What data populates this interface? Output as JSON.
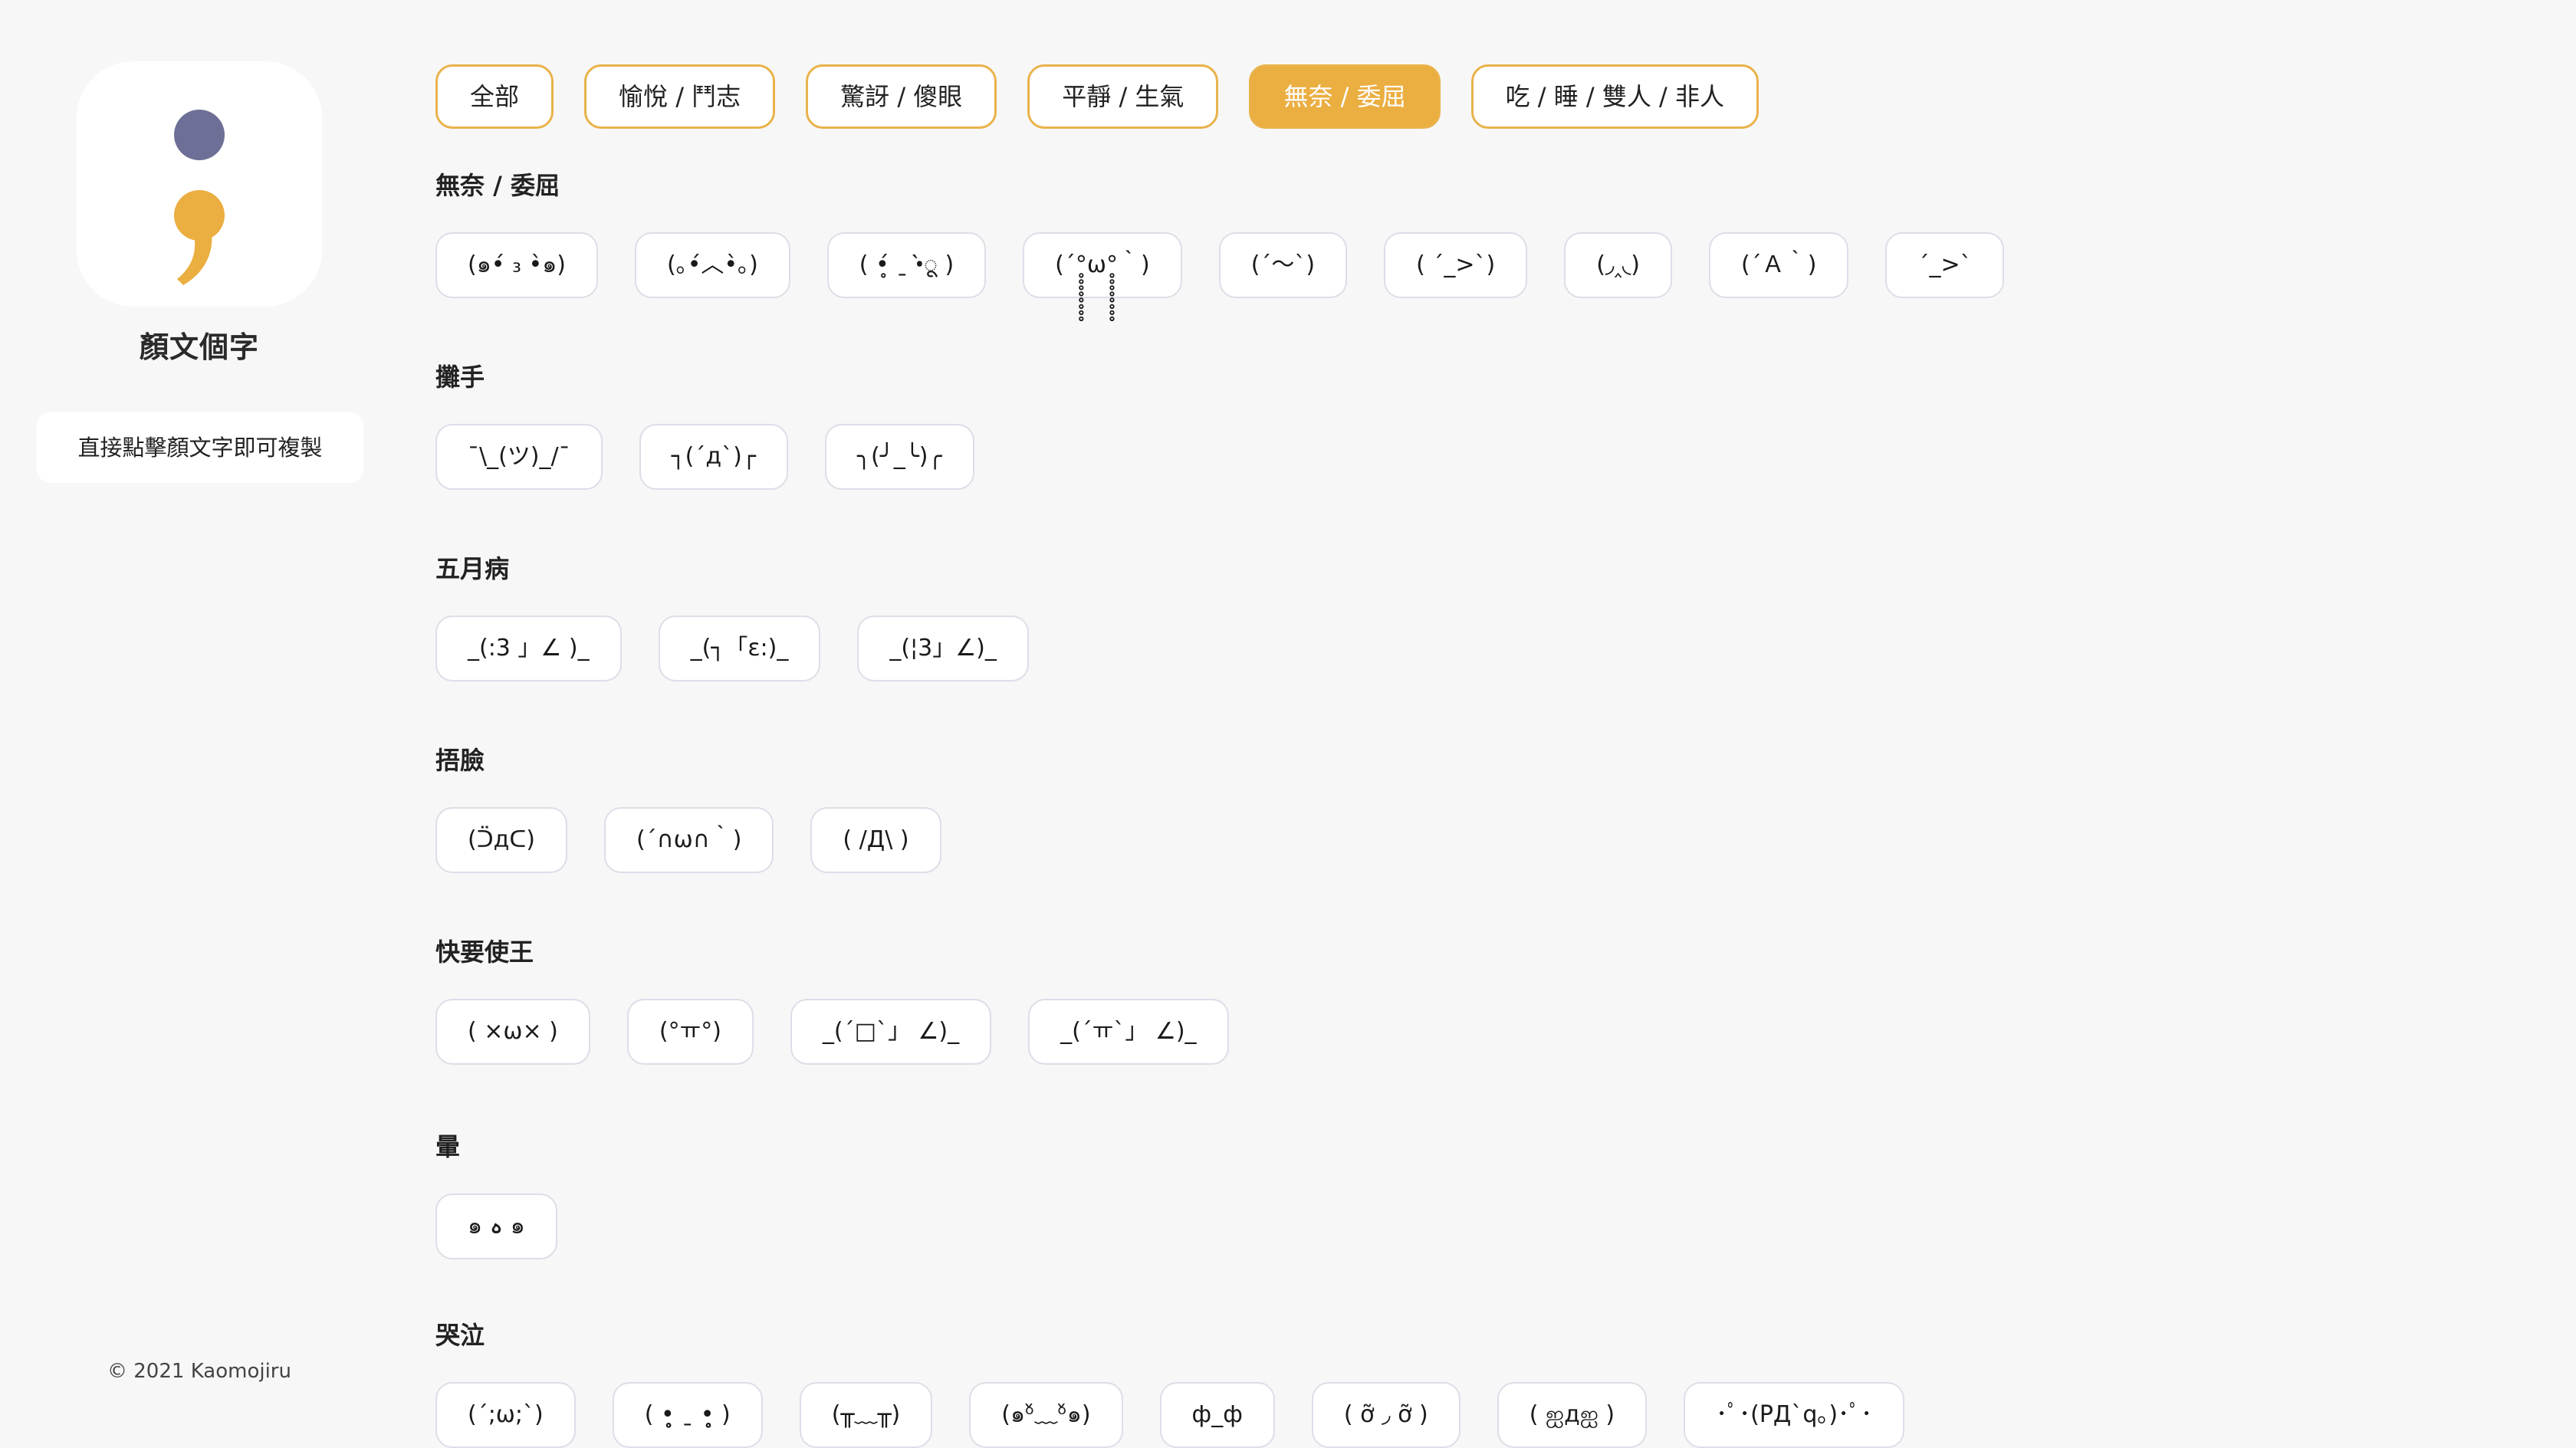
{
  "app": {
    "title": "顏文個字",
    "hint": "直接點擊顏文字即可複製",
    "footer": "© 2021 Kaomojiru",
    "colors": {
      "accent": "#ebae41",
      "logo_dot": "#6e6f96",
      "chip_border": "#dedde8",
      "background": "#f7f7f7"
    }
  },
  "tabs": [
    {
      "label": "全部",
      "active": false
    },
    {
      "label": "愉悅 / 鬥志",
      "active": false
    },
    {
      "label": "驚訝 / 傻眼",
      "active": false
    },
    {
      "label": "平靜 / 生氣",
      "active": false
    },
    {
      "label": "無奈 / 委屈",
      "active": true
    },
    {
      "label": "吃 / 睡 / 雙人 / 非人",
      "active": false
    }
  ],
  "sections": [
    {
      "title": "無奈 / 委屈",
      "items": [
        "(๑•́ ₃ •̀๑)",
        "(｡•́︿•̀｡)",
        "( •̥́ ˍ •̀ू )",
        "(´°̥̥̥̥̥̥̥̥ω°̥̥̥̥̥̥̥̥｀)",
        "(´～`)",
        "( ´_>`)",
        "(◞‸◟)",
        "(´Ａ｀)",
        "ˊ_>ˋ"
      ]
    },
    {
      "title": "攤手",
      "items": [
        "¯\\_(ツ)_/¯",
        "┐(´д`)┌",
        "╮(╯_╰)╭"
      ]
    },
    {
      "title": "五月病",
      "items": [
        "_(:3 」∠ )_",
        "_(┐「ε:)_",
        "_(¦3」∠)_"
      ]
    },
    {
      "title": "捂臉",
      "items": [
        "(ᑒдᑕ)",
        "(´∩ω∩｀)",
        "( /Д\\ )"
      ]
    },
    {
      "title": "快要使王",
      "items": [
        "( ×ω× )",
        "(°ㅠ°)",
        "_(´□`」 ∠)_",
        "_(´ㅠ`」 ∠)_"
      ]
    },
    {
      "title": "暈",
      "items": [
        "๑ ہ ๑"
      ]
    },
    {
      "title": "哭泣",
      "items": [
        "(´;ω;`)",
        "( •̥̥̥̥̥̥̥̥ ˍ •̥̥̥̥̥̥̥̥ )",
        "(╥﹏╥)",
        "(๑ᵒ̌﹏ᵒ̌๑)",
        "ф_ф",
        "( ỡ ◞ ỡ )",
        "( ஐдஐ )",
        "･ﾟ･(PД`q｡)･ﾟ･"
      ]
    }
  ]
}
